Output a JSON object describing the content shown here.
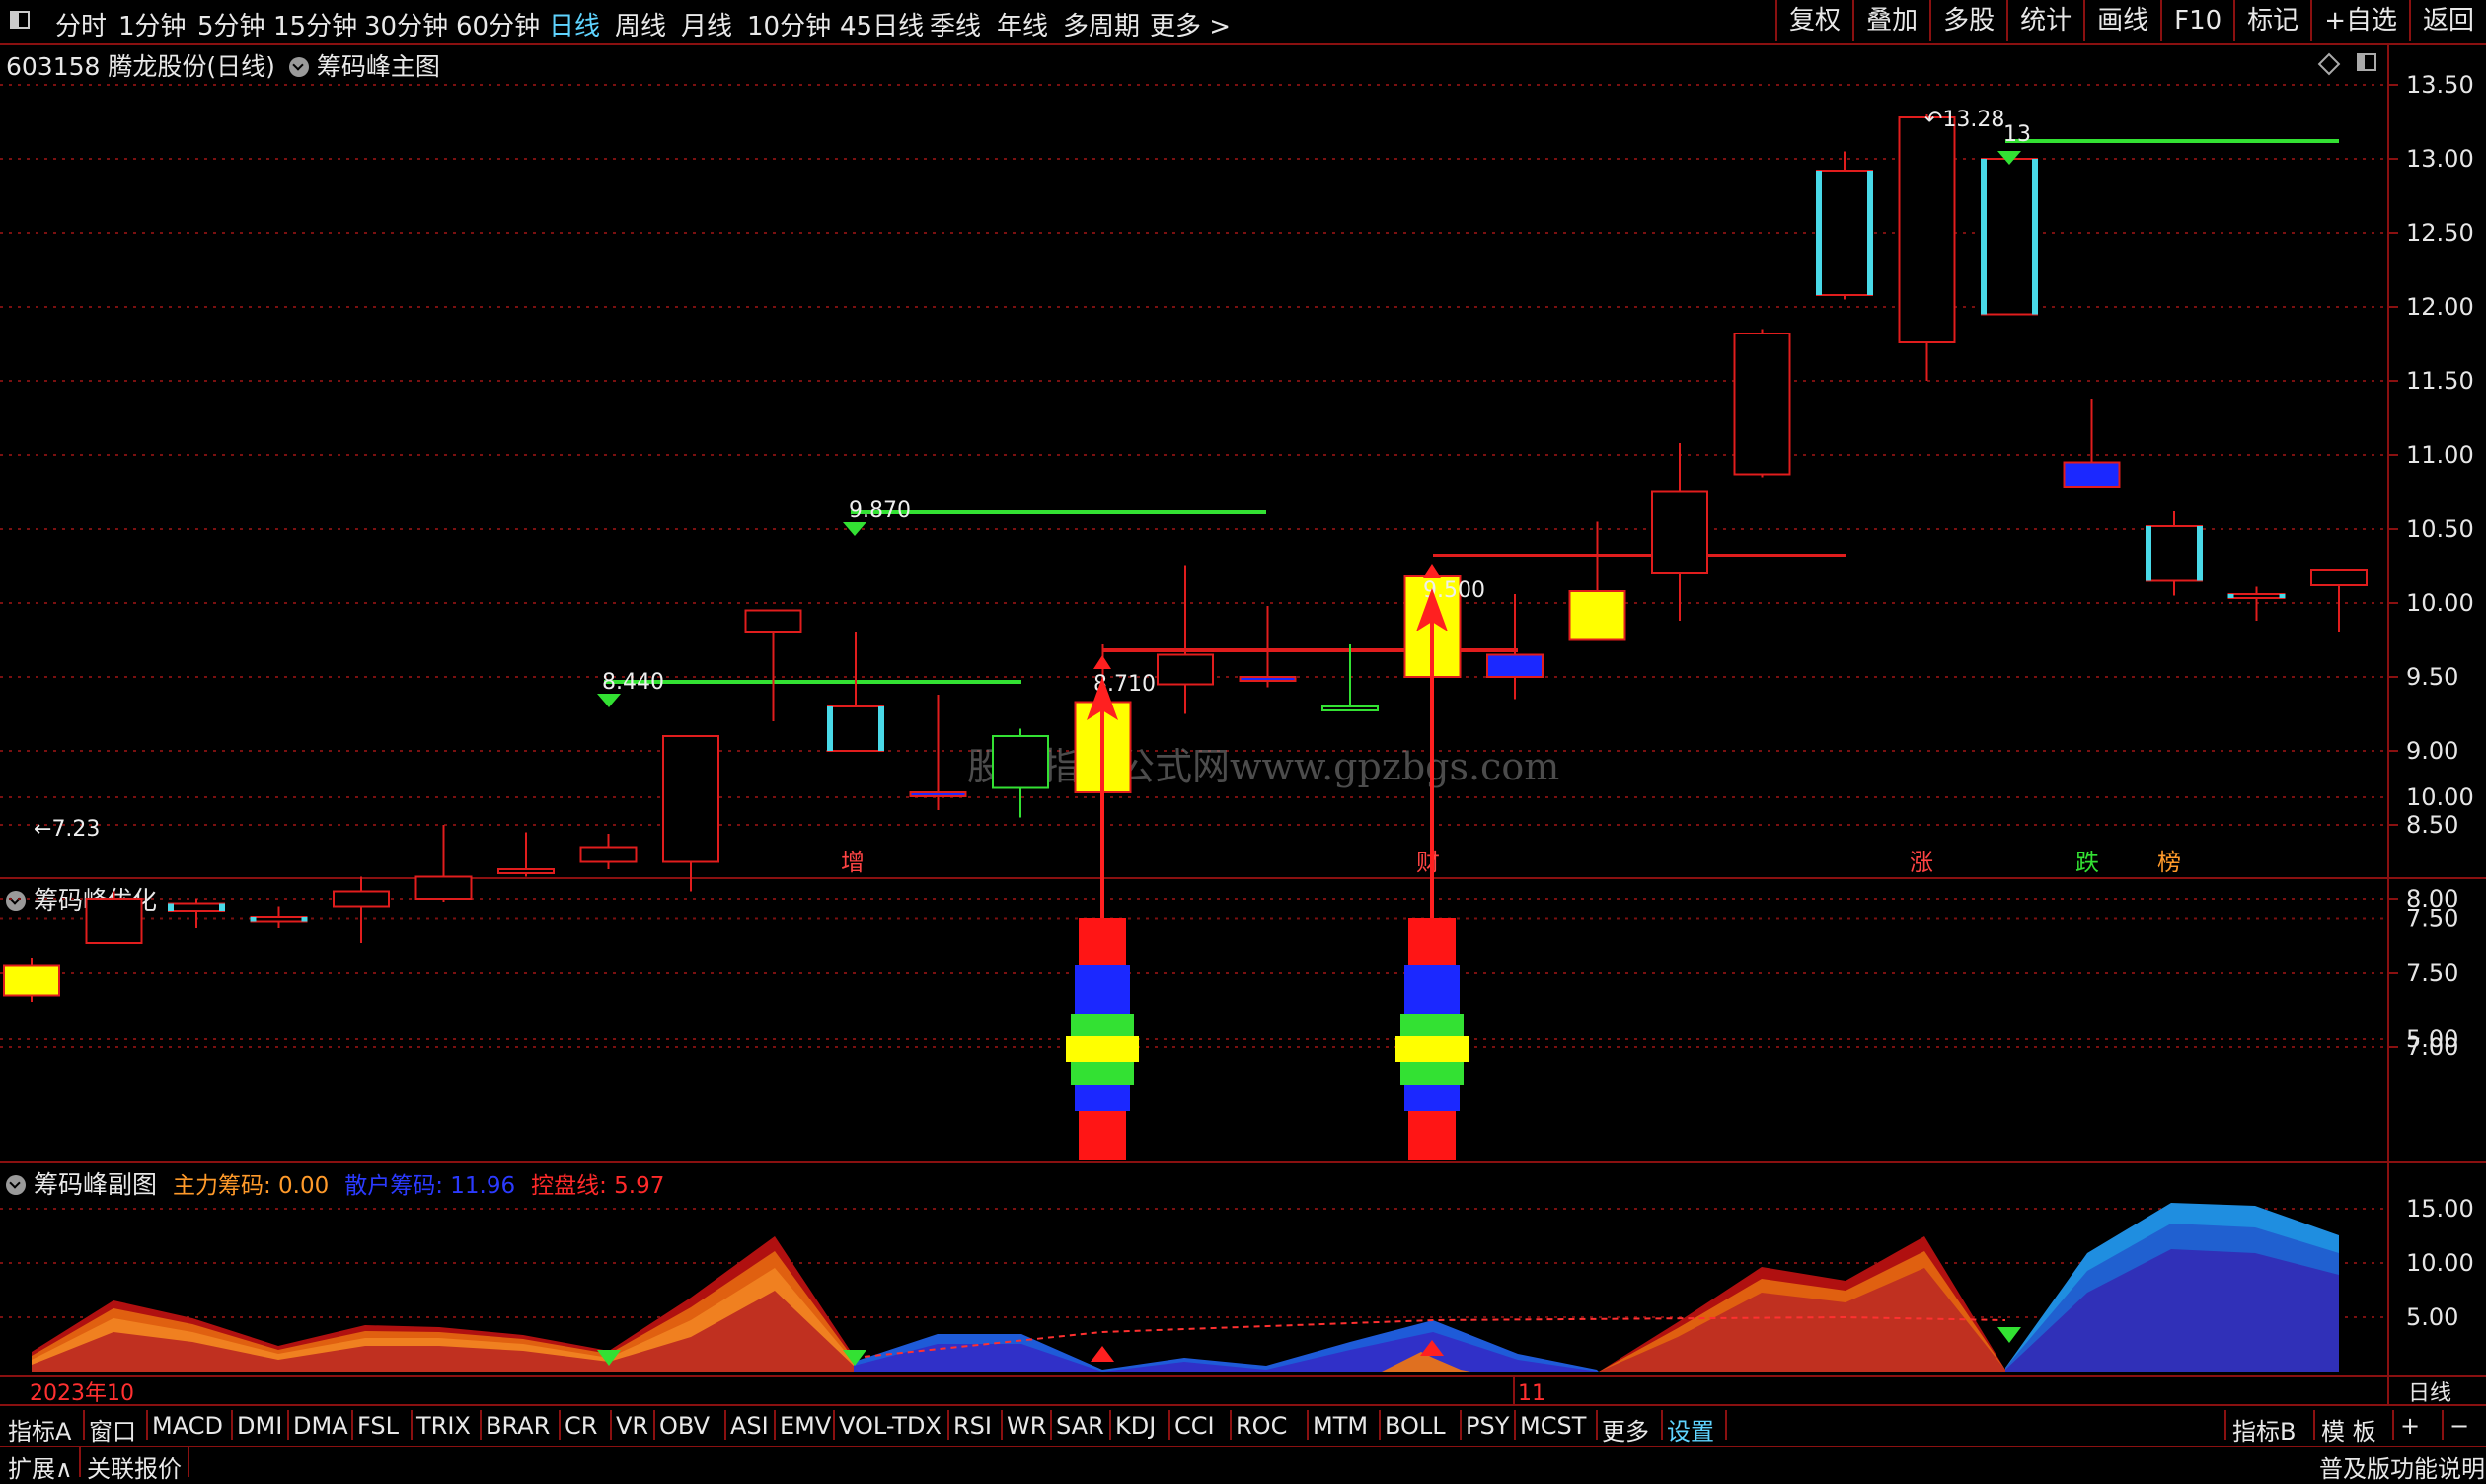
{
  "top_menu": {
    "window_icon": "window-toggle-icon",
    "periods": [
      "分时",
      "1分钟",
      "5分钟",
      "15分钟",
      "30分钟",
      "60分钟",
      "日线",
      "周线",
      "月线",
      "10分钟",
      "45日线",
      "季线",
      "年线",
      "多周期",
      "更多 >"
    ],
    "active_period": "日线",
    "right_buttons": [
      "复权",
      "叠加",
      "多股",
      "统计",
      "画线",
      "F10",
      "标记",
      "+自选",
      "返回"
    ]
  },
  "main_chart": {
    "stock_code": "603158",
    "stock_name": "腾龙股份(日线)",
    "indicator": "筹码峰主图",
    "watermark": "股票指标公式网www.gpzbgs.com",
    "y_ticks": [
      "13.50",
      "13.00",
      "12.50",
      "12.00",
      "11.50",
      "11.00",
      "10.50",
      "10.00",
      "9.50",
      "9.00",
      "8.50",
      "8.00",
      "7.50",
      "7.00"
    ],
    "annotations": [
      "7.23",
      "8.440",
      "9.870",
      "8.710",
      "9.500",
      "13.28",
      "13"
    ],
    "signal_labels": [
      "增",
      "财",
      "涨",
      "跌",
      "榜"
    ]
  },
  "sub_chart1": {
    "title": "筹码峰优化",
    "y_ticks": [
      "10.00",
      "7.50",
      "5.00"
    ]
  },
  "sub_chart2": {
    "title": "筹码峰副图",
    "main_label": "主力筹码: 0.00",
    "retail_label": "散户筹码: 11.96",
    "control_label": "控盘线: 5.97",
    "y_ticks": [
      "15.00",
      "10.00",
      "5.00"
    ]
  },
  "time_axis": {
    "start": "2023年10",
    "mid": "11",
    "period": "日线"
  },
  "indicator_tabs": [
    "指标A",
    "窗口",
    "MACD",
    "DMI",
    "DMA",
    "FSL",
    "TRIX",
    "BRAR",
    "CR",
    "VR",
    "OBV",
    "ASI",
    "EMV",
    "VOL-TDX",
    "RSI",
    "WR",
    "SAR",
    "KDJ",
    "CCI",
    "ROC",
    "MTM",
    "BOLL",
    "PSY",
    "MCST",
    "更多",
    "设置"
  ],
  "indicator_right": [
    "指标B",
    "模 板",
    "+",
    "−"
  ],
  "footer": {
    "expand": "扩展∧",
    "linked": "关联报价",
    "right": "普及版功能说明"
  },
  "chart_data": {
    "type": "candlestick",
    "dates_label": [
      "2023年10",
      "11"
    ],
    "ylim": [
      6.9,
      13.7
    ],
    "candles": [
      {
        "o": 7.35,
        "c": 7.55,
        "h": 7.6,
        "l": 7.3,
        "color": "yellow"
      },
      {
        "o": 8.0,
        "c": 7.7,
        "h": 8.05,
        "l": 7.7,
        "color": "red"
      },
      {
        "o": 7.97,
        "c": 7.92,
        "h": 8.0,
        "l": 7.8,
        "color": "cyan"
      },
      {
        "o": 7.85,
        "c": 7.88,
        "h": 7.95,
        "l": 7.8,
        "color": "cyan"
      },
      {
        "o": 7.95,
        "c": 8.05,
        "h": 8.15,
        "l": 7.7,
        "color": "red"
      },
      {
        "o": 8.0,
        "c": 8.15,
        "h": 8.5,
        "l": 7.98,
        "color": "red"
      },
      {
        "o": 8.2,
        "c": 8.2,
        "h": 8.45,
        "l": 8.15,
        "color": "red"
      },
      {
        "o": 8.25,
        "c": 8.35,
        "h": 8.44,
        "l": 8.2,
        "color": "red"
      },
      {
        "o": 8.25,
        "c": 9.1,
        "h": 9.1,
        "l": 8.05,
        "color": "red"
      },
      {
        "o": 9.8,
        "c": 9.95,
        "h": 9.95,
        "l": 9.2,
        "color": "red"
      },
      {
        "o": 9.3,
        "c": 9.0,
        "h": 9.8,
        "l": 9.0,
        "color": "cyan"
      },
      {
        "o": 8.72,
        "c": 8.72,
        "h": 9.38,
        "l": 8.6,
        "color": "blue"
      },
      {
        "o": 8.75,
        "c": 9.1,
        "h": 9.15,
        "l": 8.55,
        "color": "green"
      },
      {
        "o": 8.72,
        "c": 9.33,
        "h": 9.72,
        "l": 8.72,
        "color": "yellow"
      },
      {
        "o": 9.45,
        "c": 9.65,
        "h": 10.25,
        "l": 9.25,
        "color": "red"
      },
      {
        "o": 9.5,
        "c": 9.5,
        "h": 9.98,
        "l": 9.43,
        "color": "blue"
      },
      {
        "o": 9.3,
        "c": 9.3,
        "h": 9.72,
        "l": 9.27,
        "color": "green"
      },
      {
        "o": 9.5,
        "c": 10.18,
        "h": 10.18,
        "l": 9.5,
        "color": "yellow"
      },
      {
        "o": 9.65,
        "c": 9.5,
        "h": 10.06,
        "l": 9.35,
        "color": "blue"
      },
      {
        "o": 9.75,
        "c": 10.08,
        "h": 10.55,
        "l": 9.75,
        "color": "yellow"
      },
      {
        "o": 10.2,
        "c": 10.75,
        "h": 11.08,
        "l": 9.88,
        "color": "red"
      },
      {
        "o": 10.87,
        "c": 11.82,
        "h": 11.85,
        "l": 10.85,
        "color": "red"
      },
      {
        "o": 12.08,
        "c": 12.92,
        "h": 13.05,
        "l": 12.05,
        "color": "cyan"
      },
      {
        "o": 11.76,
        "c": 13.28,
        "h": 13.3,
        "l": 11.5,
        "color": "red"
      },
      {
        "o": 11.95,
        "c": 13.0,
        "h": 13.0,
        "l": 11.95,
        "color": "cyan"
      },
      {
        "o": 10.95,
        "c": 10.78,
        "h": 11.38,
        "l": 10.78,
        "color": "blue"
      },
      {
        "o": 10.15,
        "c": 10.52,
        "h": 10.62,
        "l": 10.05,
        "color": "cyan"
      },
      {
        "o": 10.05,
        "c": 10.06,
        "h": 10.11,
        "l": 9.88,
        "color": "cyan"
      },
      {
        "o": 10.12,
        "c": 10.22,
        "h": 10.22,
        "l": 9.8,
        "color": "red"
      }
    ]
  },
  "colors": {
    "grid": "#8a1010",
    "up": "#e11d1d",
    "cyan": "#49d9e8",
    "yellow": "#ffff00",
    "blue": "#1b28ff",
    "green": "#33e133",
    "axis_text": "#e6e6e6"
  }
}
